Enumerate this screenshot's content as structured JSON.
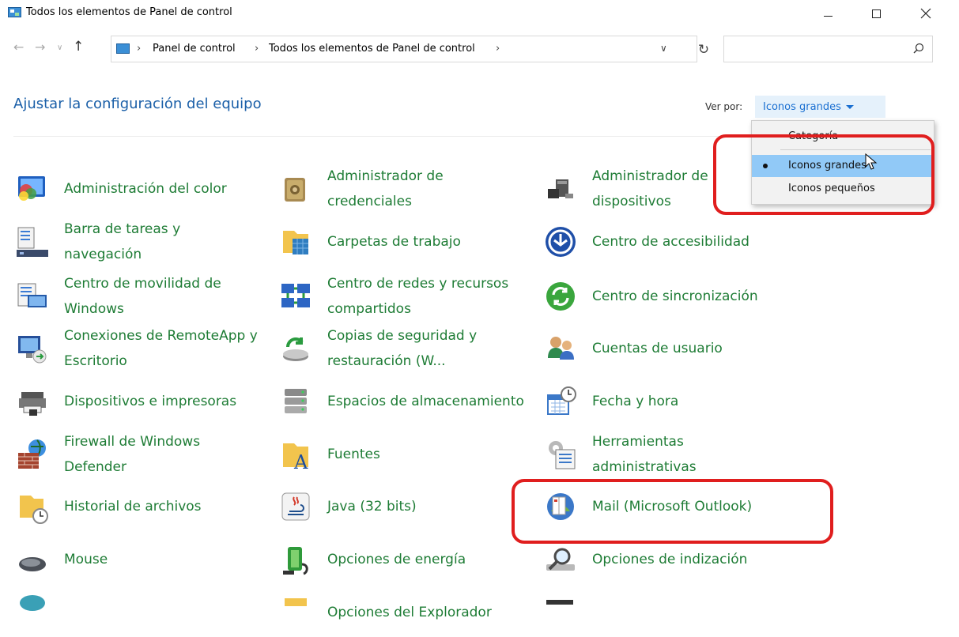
{
  "window": {
    "title": "Todos los elementos de Panel de control"
  },
  "address": {
    "crumbs": [
      "Panel de control",
      "Todos los elementos de Panel de control"
    ],
    "search_placeholder": ""
  },
  "header": {
    "title": "Ajustar la configuración del equipo",
    "view_by_label": "Ver por:",
    "view_by_value": "Iconos grandes"
  },
  "view_menu": {
    "items": [
      {
        "label": "Categoría",
        "selected": false
      },
      {
        "label": "Iconos grandes",
        "selected": true
      },
      {
        "label": "Iconos pequeños",
        "selected": false
      }
    ]
  },
  "items": [
    {
      "label": "Administración del color",
      "icon": "color-management-icon"
    },
    {
      "label": "Administrador de credenciales",
      "icon": "credential-manager-icon"
    },
    {
      "label": "Administrador de dispositivos",
      "icon": "device-manager-icon"
    },
    {
      "label": "Barra de tareas y navegación",
      "icon": "taskbar-icon"
    },
    {
      "label": "Carpetas de trabajo",
      "icon": "work-folders-icon"
    },
    {
      "label": "Centro de accesibilidad",
      "icon": "accessibility-icon"
    },
    {
      "label": "Centro de movilidad de Windows",
      "icon": "mobility-center-icon"
    },
    {
      "label": "Centro de redes y recursos compartidos",
      "icon": "network-center-icon"
    },
    {
      "label": "Centro de sincronización",
      "icon": "sync-center-icon"
    },
    {
      "label": "Conexiones de RemoteApp y Escritorio",
      "icon": "remoteapp-icon"
    },
    {
      "label": "Copias de seguridad y restauración (W...",
      "icon": "backup-icon"
    },
    {
      "label": "Cuentas de usuario",
      "icon": "user-accounts-icon"
    },
    {
      "label": "Dispositivos e impresoras",
      "icon": "printer-icon"
    },
    {
      "label": "Espacios de almacenamiento",
      "icon": "storage-spaces-icon"
    },
    {
      "label": "Fecha y hora",
      "icon": "date-time-icon"
    },
    {
      "label": "Firewall de Windows Defender",
      "icon": "firewall-icon"
    },
    {
      "label": "Fuentes",
      "icon": "fonts-icon"
    },
    {
      "label": "Herramientas administrativas",
      "icon": "admin-tools-icon"
    },
    {
      "label": "Historial de archivos",
      "icon": "file-history-icon"
    },
    {
      "label": "Java (32 bits)",
      "icon": "java-icon"
    },
    {
      "label": "Mail (Microsoft Outlook)",
      "icon": "mail-icon"
    },
    {
      "label": "Mouse",
      "icon": "mouse-icon"
    },
    {
      "label": "Opciones de energía",
      "icon": "power-options-icon"
    },
    {
      "label": "Opciones de indización",
      "icon": "indexing-icon"
    },
    {
      "label": "",
      "icon": "partial-icon"
    },
    {
      "label": "Opciones del Explorador",
      "icon": "partial-icon"
    },
    {
      "label": "",
      "icon": "partial-icon"
    }
  ]
}
